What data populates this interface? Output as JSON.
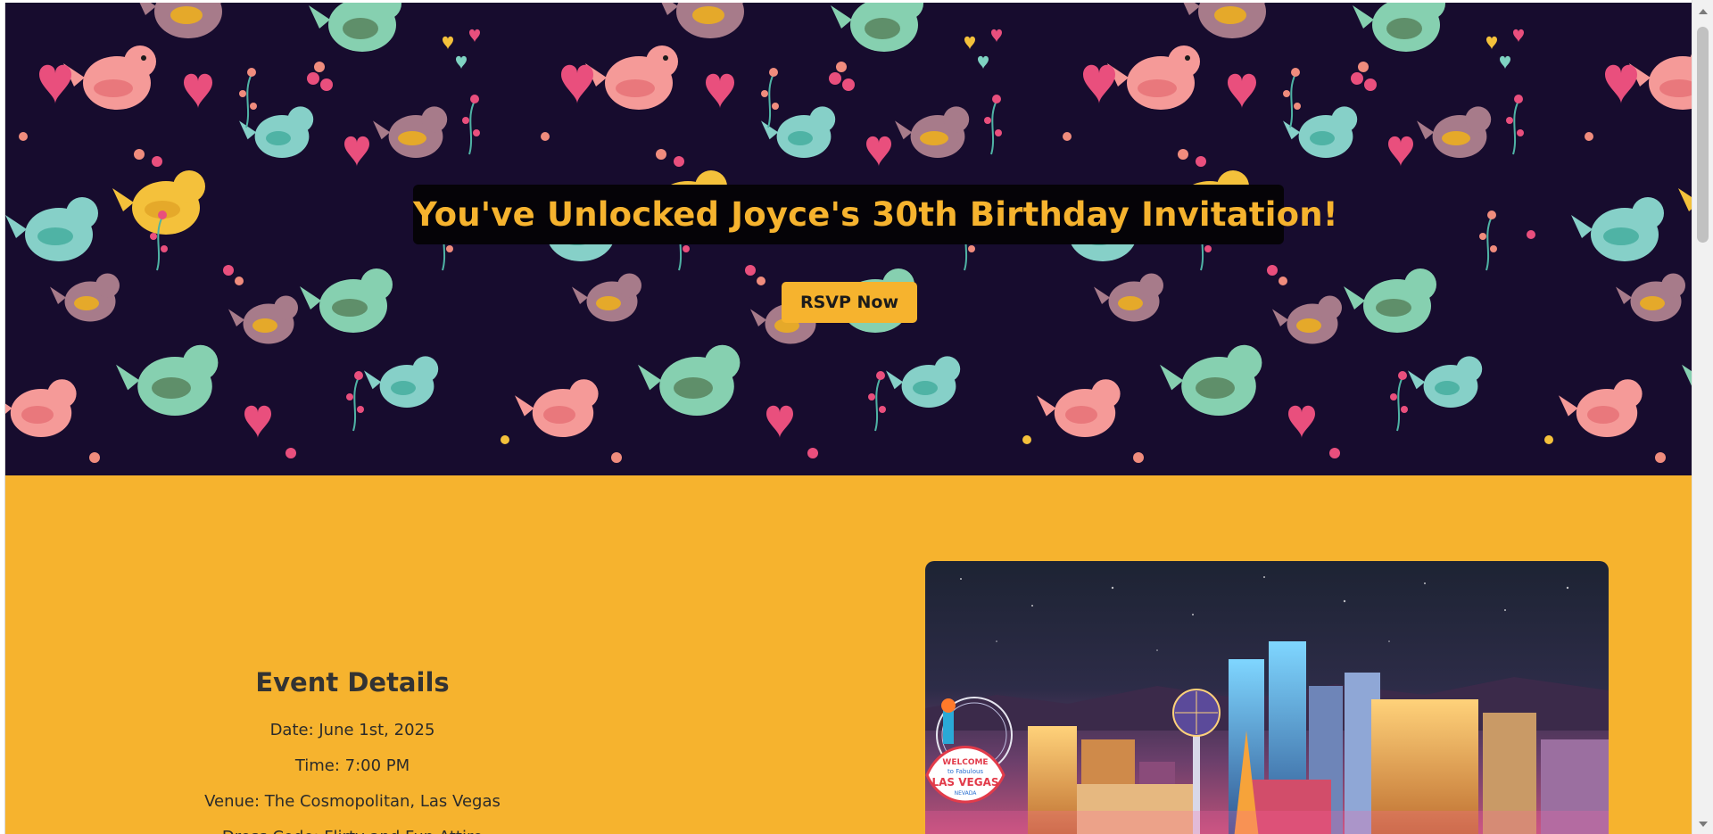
{
  "hero": {
    "title": "You've Unlocked Joyce's 30th Birthday Invitation!",
    "rsvp_label": "RSVP Now",
    "background_color": "#170c2e",
    "accent_color": "#f6b32e"
  },
  "details": {
    "heading": "Event Details",
    "lines": [
      "Date: June 1st, 2025",
      "Time: 7:00 PM",
      "Venue: The Cosmopolitan, Las Vegas",
      "Dress Code: Flirty and Fun Attire"
    ],
    "background_color": "#f6b32e"
  },
  "city_image": {
    "sign_line1": "WELCOME",
    "sign_line2": "to Fabulous",
    "sign_line3": "LAS VEGAS",
    "sign_line4": "NEVADA"
  },
  "icons": {
    "pattern": "bird-heart-pattern",
    "scroll_up": "chevron-up-icon",
    "scroll_down": "chevron-down-icon"
  }
}
